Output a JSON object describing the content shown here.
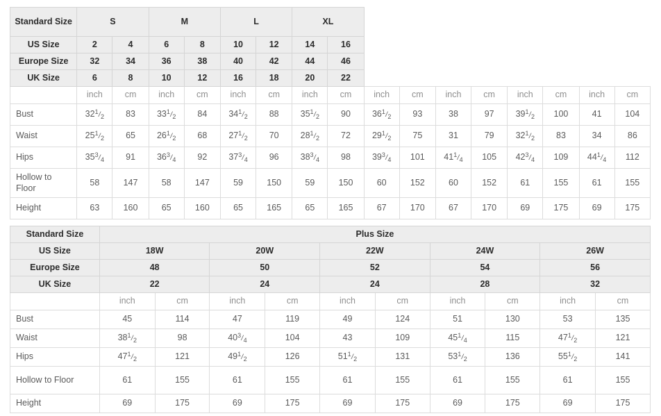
{
  "meta": {
    "row_label_headers": [
      "Standard Size",
      "US Size",
      "Europe Size",
      "UK Size"
    ],
    "measure_rows": [
      "Bust",
      "Waist",
      "Hips",
      "Hollow to Floor",
      "Height"
    ],
    "unit_inch": "inch",
    "unit_cm": "cm",
    "colors": {
      "header_bg": "#ededed",
      "cell_bg": "#ffffff",
      "border": "#dcdcdc",
      "header_text": "#2b2b2b",
      "body_text": "#5a5a5a",
      "unit_text": "#8e8e8e"
    }
  },
  "table1": {
    "group_label": "Standard Size",
    "groups": [
      {
        "label": "S",
        "span": 2
      },
      {
        "label": "M",
        "span": 2
      },
      {
        "label": "L",
        "span": 2
      },
      {
        "label": "XL",
        "span": 2
      }
    ],
    "us_size_label": "US Size",
    "us_sizes": [
      "2",
      "4",
      "6",
      "8",
      "10",
      "12",
      "14",
      "16"
    ],
    "europe_size_label": "Europe Size",
    "europe_sizes": [
      "32",
      "34",
      "36",
      "38",
      "40",
      "42",
      "44",
      "46"
    ],
    "uk_size_label": "UK Size",
    "uk_sizes": [
      "6",
      "8",
      "10",
      "12",
      "16",
      "18",
      "20",
      "22"
    ],
    "rows": [
      {
        "label": "Bust",
        "inch": [
          "32 1/2",
          "33 1/2",
          "34 1/2",
          "35 1/2",
          "36 1/2",
          "38",
          "39 1/2",
          "41"
        ],
        "cm": [
          "83",
          "84",
          "88",
          "90",
          "93",
          "97",
          "100",
          "104"
        ]
      },
      {
        "label": "Waist",
        "inch": [
          "25 1/2",
          "26 1/2",
          "27 1/2",
          "28 1/2",
          "29 1/2",
          "31",
          "32 1/2",
          "34"
        ],
        "cm": [
          "65",
          "68",
          "70",
          "72",
          "75",
          "79",
          "83",
          "86"
        ]
      },
      {
        "label": "Hips",
        "inch": [
          "35 3/4",
          "36 3/4",
          "37 3/4",
          "38 3/4",
          "39 3/4",
          "41 1/4",
          "42 3/4",
          "44 1/4"
        ],
        "cm": [
          "91",
          "92",
          "96",
          "98",
          "101",
          "105",
          "109",
          "112"
        ]
      },
      {
        "label": "Hollow to Floor",
        "inch": [
          "58",
          "58",
          "59",
          "59",
          "60",
          "60",
          "61",
          "61"
        ],
        "cm": [
          "147",
          "147",
          "150",
          "150",
          "152",
          "152",
          "155",
          "155"
        ]
      },
      {
        "label": "Height",
        "inch": [
          "63",
          "65",
          "65",
          "65",
          "67",
          "67",
          "69",
          "69"
        ],
        "cm": [
          "160",
          "160",
          "165",
          "165",
          "170",
          "170",
          "175",
          "175"
        ]
      }
    ]
  },
  "table2": {
    "group_label": "Standard Size",
    "plus_size_label": "Plus Size",
    "us_size_label": "US Size",
    "us_sizes": [
      "18W",
      "20W",
      "22W",
      "24W",
      "26W"
    ],
    "europe_size_label": "Europe Size",
    "europe_sizes": [
      "48",
      "50",
      "52",
      "54",
      "56"
    ],
    "uk_size_label": "UK Size",
    "uk_sizes": [
      "22",
      "24",
      "24",
      "28",
      "32"
    ],
    "rows": [
      {
        "label": "Bust",
        "inch": [
          "45",
          "47",
          "49",
          "51",
          "53"
        ],
        "cm": [
          "114",
          "119",
          "124",
          "130",
          "135"
        ]
      },
      {
        "label": "Waist",
        "inch": [
          "38 1/2",
          "40 3/4",
          "43",
          "45 1/4",
          "47 1/2"
        ],
        "cm": [
          "98",
          "104",
          "109",
          "115",
          "121"
        ]
      },
      {
        "label": "Hips",
        "inch": [
          "47 1/2",
          "49 1/2",
          "51 1/2",
          "53 1/2",
          "55 1/2"
        ],
        "cm": [
          "121",
          "126",
          "131",
          "136",
          "141"
        ]
      },
      {
        "label": "Hollow to Floor",
        "inch": [
          "61",
          "61",
          "61",
          "61",
          "61"
        ],
        "cm": [
          "155",
          "155",
          "155",
          "155",
          "155"
        ]
      },
      {
        "label": "Height",
        "inch": [
          "69",
          "69",
          "69",
          "69",
          "69"
        ],
        "cm": [
          "175",
          "175",
          "175",
          "175",
          "175"
        ]
      }
    ]
  }
}
